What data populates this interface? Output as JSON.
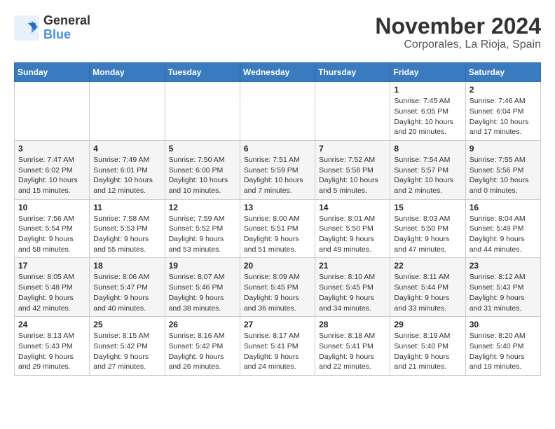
{
  "logo": {
    "line1": "General",
    "line2": "Blue"
  },
  "title": "November 2024",
  "subtitle": "Corporales, La Rioja, Spain",
  "days_of_week": [
    "Sunday",
    "Monday",
    "Tuesday",
    "Wednesday",
    "Thursday",
    "Friday",
    "Saturday"
  ],
  "weeks": [
    [
      {
        "day": "",
        "info": ""
      },
      {
        "day": "",
        "info": ""
      },
      {
        "day": "",
        "info": ""
      },
      {
        "day": "",
        "info": ""
      },
      {
        "day": "",
        "info": ""
      },
      {
        "day": "1",
        "info": "Sunrise: 7:45 AM\nSunset: 6:05 PM\nDaylight: 10 hours and 20 minutes."
      },
      {
        "day": "2",
        "info": "Sunrise: 7:46 AM\nSunset: 6:04 PM\nDaylight: 10 hours and 17 minutes."
      }
    ],
    [
      {
        "day": "3",
        "info": "Sunrise: 7:47 AM\nSunset: 6:02 PM\nDaylight: 10 hours and 15 minutes."
      },
      {
        "day": "4",
        "info": "Sunrise: 7:49 AM\nSunset: 6:01 PM\nDaylight: 10 hours and 12 minutes."
      },
      {
        "day": "5",
        "info": "Sunrise: 7:50 AM\nSunset: 6:00 PM\nDaylight: 10 hours and 10 minutes."
      },
      {
        "day": "6",
        "info": "Sunrise: 7:51 AM\nSunset: 5:59 PM\nDaylight: 10 hours and 7 minutes."
      },
      {
        "day": "7",
        "info": "Sunrise: 7:52 AM\nSunset: 5:58 PM\nDaylight: 10 hours and 5 minutes."
      },
      {
        "day": "8",
        "info": "Sunrise: 7:54 AM\nSunset: 5:57 PM\nDaylight: 10 hours and 2 minutes."
      },
      {
        "day": "9",
        "info": "Sunrise: 7:55 AM\nSunset: 5:56 PM\nDaylight: 10 hours and 0 minutes."
      }
    ],
    [
      {
        "day": "10",
        "info": "Sunrise: 7:56 AM\nSunset: 5:54 PM\nDaylight: 9 hours and 58 minutes."
      },
      {
        "day": "11",
        "info": "Sunrise: 7:58 AM\nSunset: 5:53 PM\nDaylight: 9 hours and 55 minutes."
      },
      {
        "day": "12",
        "info": "Sunrise: 7:59 AM\nSunset: 5:52 PM\nDaylight: 9 hours and 53 minutes."
      },
      {
        "day": "13",
        "info": "Sunrise: 8:00 AM\nSunset: 5:51 PM\nDaylight: 9 hours and 51 minutes."
      },
      {
        "day": "14",
        "info": "Sunrise: 8:01 AM\nSunset: 5:50 PM\nDaylight: 9 hours and 49 minutes."
      },
      {
        "day": "15",
        "info": "Sunrise: 8:03 AM\nSunset: 5:50 PM\nDaylight: 9 hours and 47 minutes."
      },
      {
        "day": "16",
        "info": "Sunrise: 8:04 AM\nSunset: 5:49 PM\nDaylight: 9 hours and 44 minutes."
      }
    ],
    [
      {
        "day": "17",
        "info": "Sunrise: 8:05 AM\nSunset: 5:48 PM\nDaylight: 9 hours and 42 minutes."
      },
      {
        "day": "18",
        "info": "Sunrise: 8:06 AM\nSunset: 5:47 PM\nDaylight: 9 hours and 40 minutes."
      },
      {
        "day": "19",
        "info": "Sunrise: 8:07 AM\nSunset: 5:46 PM\nDaylight: 9 hours and 38 minutes."
      },
      {
        "day": "20",
        "info": "Sunrise: 8:09 AM\nSunset: 5:45 PM\nDaylight: 9 hours and 36 minutes."
      },
      {
        "day": "21",
        "info": "Sunrise: 8:10 AM\nSunset: 5:45 PM\nDaylight: 9 hours and 34 minutes."
      },
      {
        "day": "22",
        "info": "Sunrise: 8:11 AM\nSunset: 5:44 PM\nDaylight: 9 hours and 33 minutes."
      },
      {
        "day": "23",
        "info": "Sunrise: 8:12 AM\nSunset: 5:43 PM\nDaylight: 9 hours and 31 minutes."
      }
    ],
    [
      {
        "day": "24",
        "info": "Sunrise: 8:13 AM\nSunset: 5:43 PM\nDaylight: 9 hours and 29 minutes."
      },
      {
        "day": "25",
        "info": "Sunrise: 8:15 AM\nSunset: 5:42 PM\nDaylight: 9 hours and 27 minutes."
      },
      {
        "day": "26",
        "info": "Sunrise: 8:16 AM\nSunset: 5:42 PM\nDaylight: 9 hours and 26 minutes."
      },
      {
        "day": "27",
        "info": "Sunrise: 8:17 AM\nSunset: 5:41 PM\nDaylight: 9 hours and 24 minutes."
      },
      {
        "day": "28",
        "info": "Sunrise: 8:18 AM\nSunset: 5:41 PM\nDaylight: 9 hours and 22 minutes."
      },
      {
        "day": "29",
        "info": "Sunrise: 8:19 AM\nSunset: 5:40 PM\nDaylight: 9 hours and 21 minutes."
      },
      {
        "day": "30",
        "info": "Sunrise: 8:20 AM\nSunset: 5:40 PM\nDaylight: 9 hours and 19 minutes."
      }
    ]
  ]
}
